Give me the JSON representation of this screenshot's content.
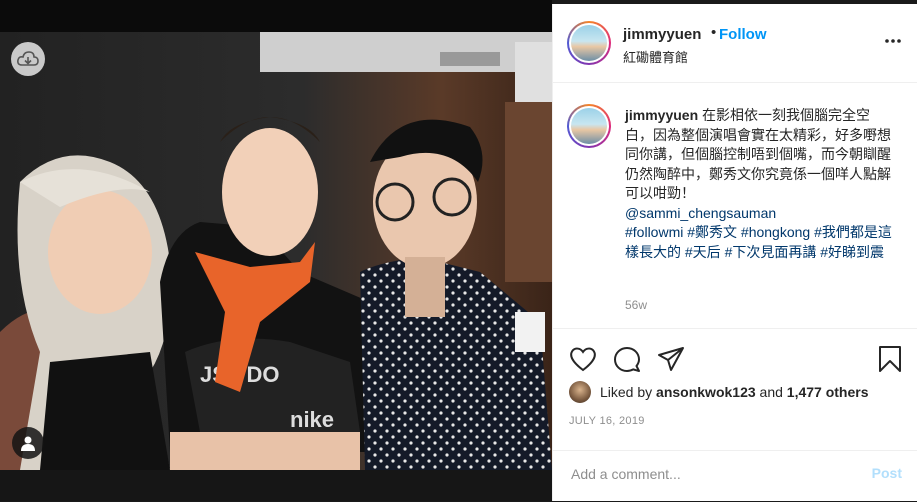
{
  "post": {
    "username": "jimmyyuen",
    "dot": "•",
    "follow_label": "Follow",
    "location": "紅磡體育館"
  },
  "caption": {
    "username": "jimmyyuen",
    "text": "在影相依一刻我個腦完全空白，因為整個演唱會實在太精彩，好多嘢想同你講，但個腦控制唔到個嘴，而今朝瞓醒仍然陶醉中，鄭秀文你究竟係一個咩人點解可以咁勁！",
    "mention": "@sammi_chengsauman",
    "hashtags": "#followmi #鄭秀文 #hongkong #我們都是這樣長大的 #天后 #下次見面再講 #好睇到震",
    "time_ago": "56w"
  },
  "likes": {
    "prefix": "Liked by",
    "user": "ansonkwok123",
    "middle": "and",
    "others": "1,477 others"
  },
  "date": "JULY 16, 2019",
  "comment": {
    "placeholder": "Add a comment...",
    "post_label": "Post"
  },
  "icons": {
    "like": "heart-icon",
    "comment": "comment-icon",
    "share": "share-icon",
    "save": "bookmark-icon",
    "more": "more-icon",
    "cloud": "cloud-download-icon",
    "tags": "user-tag-icon"
  },
  "colors": {
    "follow": "#0095f6",
    "link": "#00376b",
    "muted": "#8e8e8e",
    "post_disabled": "#b2dffc"
  }
}
